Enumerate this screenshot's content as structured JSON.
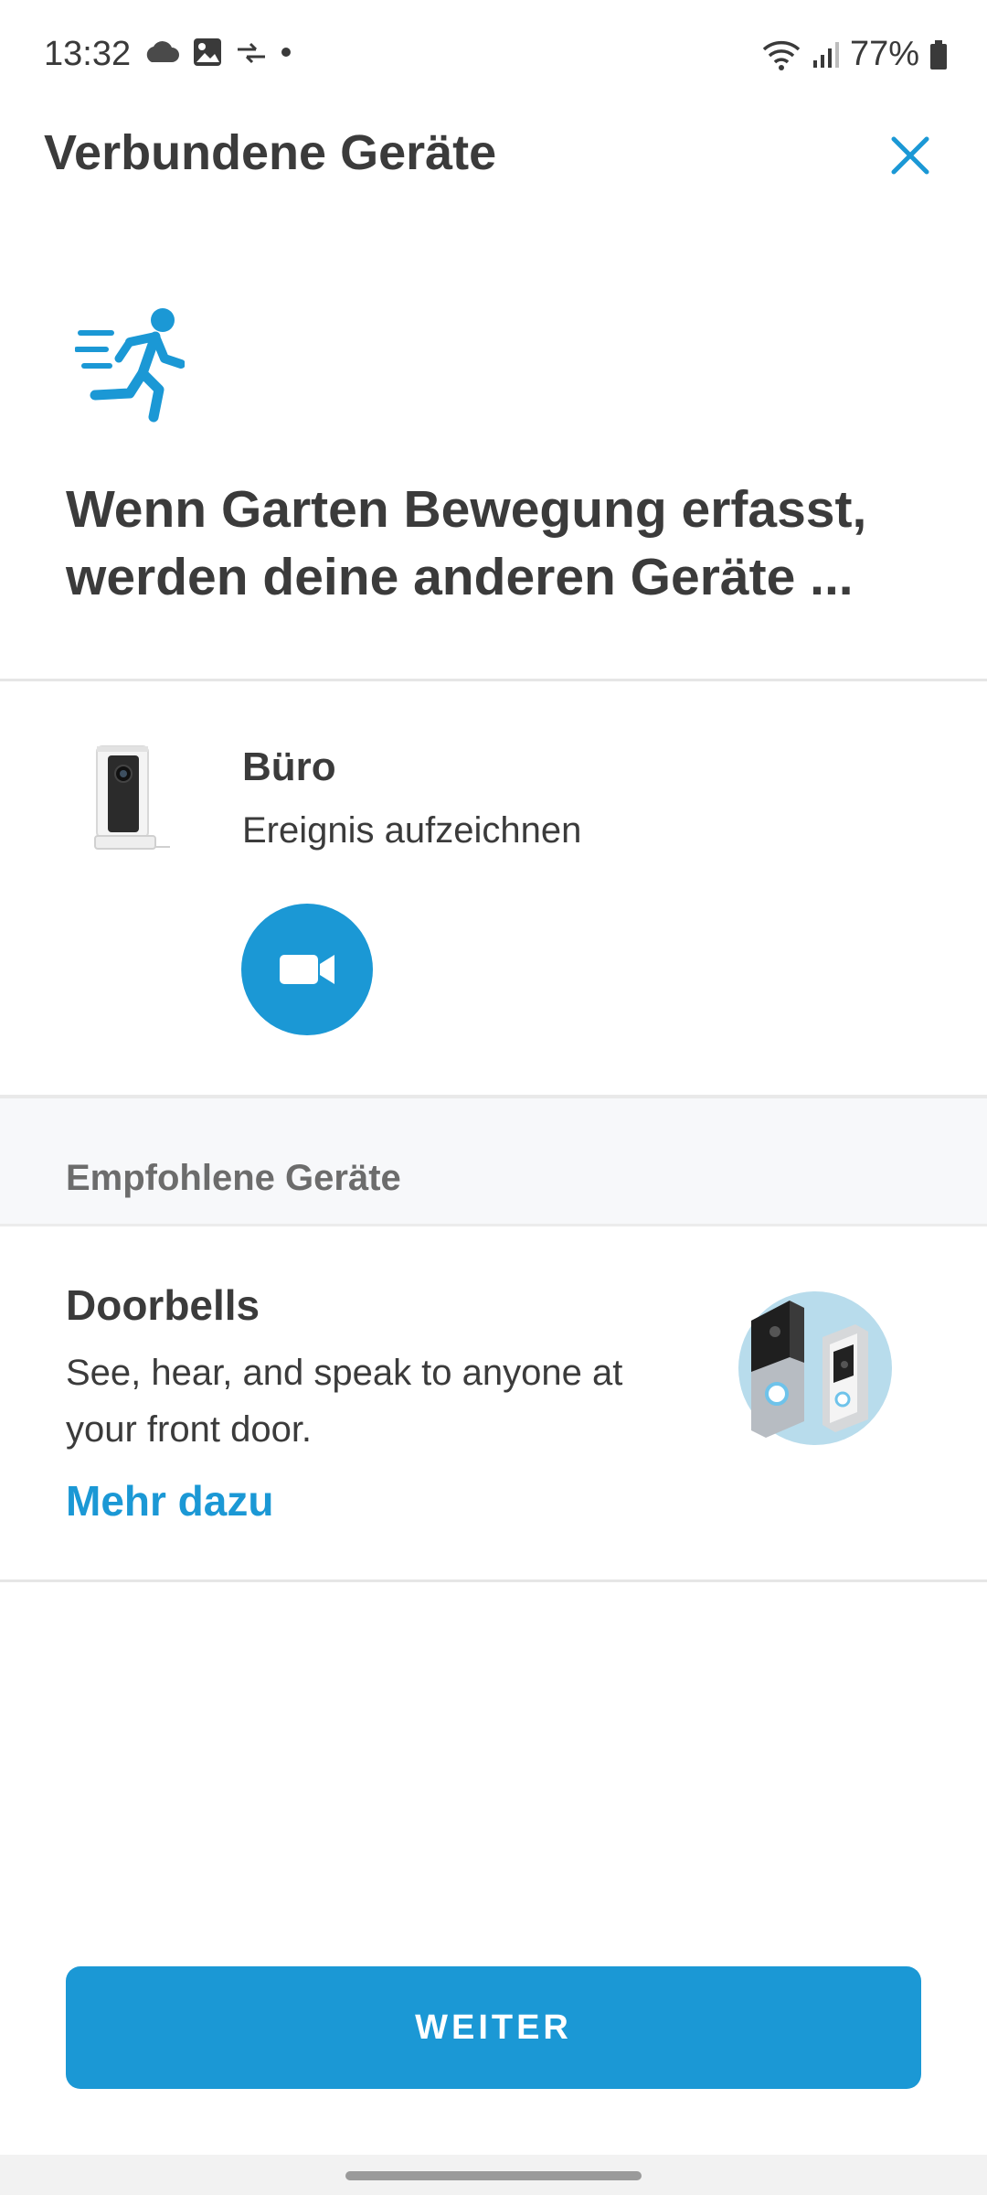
{
  "status_bar": {
    "time": "13:32",
    "battery": "77%",
    "icons_left": [
      "cloud-icon",
      "image-icon",
      "sync-arrows-icon",
      "dot-icon"
    ],
    "icons_right": [
      "wifi-icon",
      "signal-icon",
      "battery-icon"
    ]
  },
  "header": {
    "title": "Verbundene Geräte",
    "close_icon": "close-icon"
  },
  "hero": {
    "icon": "running-person-icon",
    "text": "Wenn Garten Bewegung erfasst, werden deine anderen Geräte ..."
  },
  "device": {
    "name": "Büro",
    "action": "Ereignis aufzeichnen",
    "action_icon": "video-camera-icon"
  },
  "recommended": {
    "section_title": "Empfohlene Geräte",
    "card": {
      "title": "Doorbells",
      "description": "See, hear, and speak to anyone at your front door.",
      "link": "Mehr dazu"
    }
  },
  "footer": {
    "button_label": "WEITER"
  },
  "colors": {
    "accent": "#1b98d5",
    "text": "#3b3b3b",
    "muted": "#6c6c6c"
  }
}
